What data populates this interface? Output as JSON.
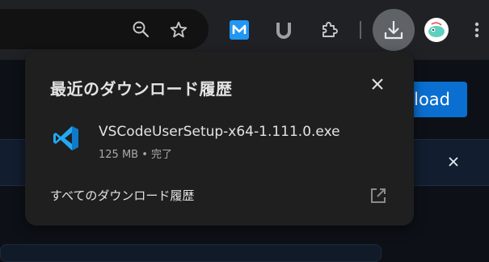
{
  "toolbar": {
    "icons": [
      "zoom-icon",
      "star-icon",
      "extension-m-icon",
      "extension-u-icon",
      "puzzle-icon",
      "download-icon",
      "avatar",
      "menu-icon"
    ],
    "ext_m_color": "#2196f3",
    "download_btn_color": "#5f6368"
  },
  "page": {
    "blue_button_label": "load"
  },
  "download_panel": {
    "title": "最近のダウンロード履歴",
    "items": [
      {
        "file_name": "VSCodeUserSetup-x64-1.111.0.exe",
        "status": "125 MB • 完了",
        "icon": "vscode-icon"
      }
    ],
    "all_history_label": "すべてのダウンロード履歴"
  },
  "colors": {
    "panel_bg": "#1f1f1f",
    "text_primary": "#e3e3e3",
    "text_secondary": "#aaaaaa",
    "vscode_blue": "#23a9f2",
    "page_button": "#0a6fd1"
  }
}
